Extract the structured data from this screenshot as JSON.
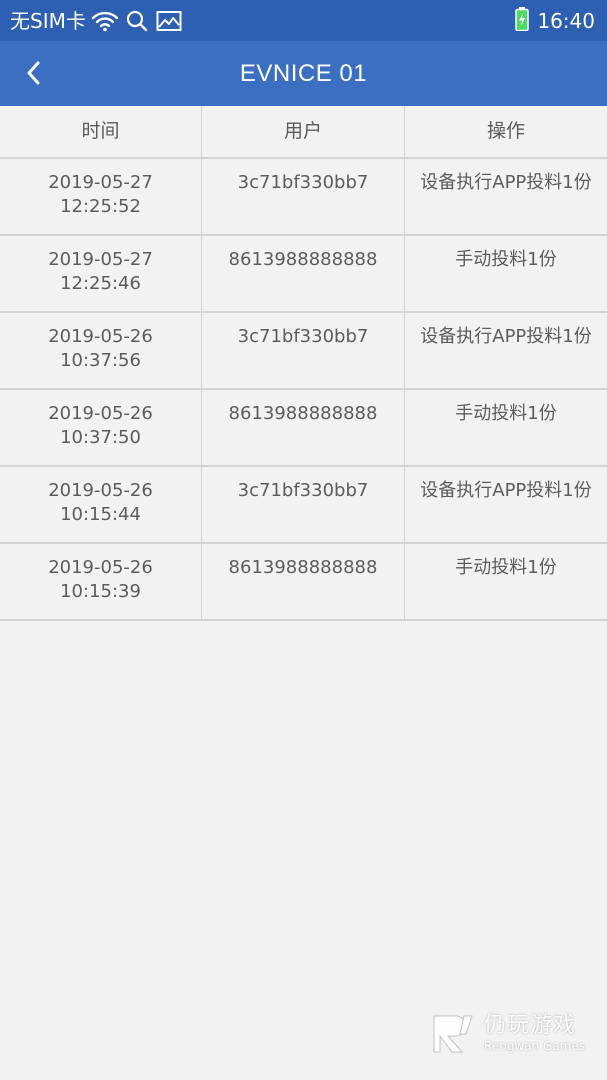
{
  "status_bar": {
    "carrier": "无SIM卡",
    "time": "16:40",
    "icons": [
      "wifi-icon",
      "search-icon",
      "image-icon",
      "battery-charging-icon"
    ]
  },
  "app_bar": {
    "title": "EVNICE 01",
    "back_icon": "chevron-left-icon"
  },
  "table": {
    "headers": [
      "时间",
      "用户",
      "操作"
    ],
    "rows": [
      {
        "time": "2019-05-27\n12:25:52",
        "user": "3c71bf330bb7",
        "action": "设备执行APP投料1份"
      },
      {
        "time": "2019-05-27\n12:25:46",
        "user": "8613988888888",
        "action": "手动投料1份"
      },
      {
        "time": "2019-05-26\n10:37:56",
        "user": "3c71bf330bb7",
        "action": "设备执行APP投料1份"
      },
      {
        "time": "2019-05-26\n10:37:50",
        "user": "8613988888888",
        "action": "手动投料1份"
      },
      {
        "time": "2019-05-26\n10:15:44",
        "user": "3c71bf330bb7",
        "action": "设备执行APP投料1份"
      },
      {
        "time": "2019-05-26\n10:15:39",
        "user": "8613988888888",
        "action": "手动投料1份"
      }
    ]
  },
  "watermark": {
    "name_cn": "仍玩游戏",
    "name_en": "Rengwan Games"
  },
  "colors": {
    "status_bar": "#2d5fb2",
    "app_bar": "#3a6fc2",
    "background": "#f2f2f2",
    "text": "#5c5c5c",
    "divider": "#d3d3d3"
  }
}
